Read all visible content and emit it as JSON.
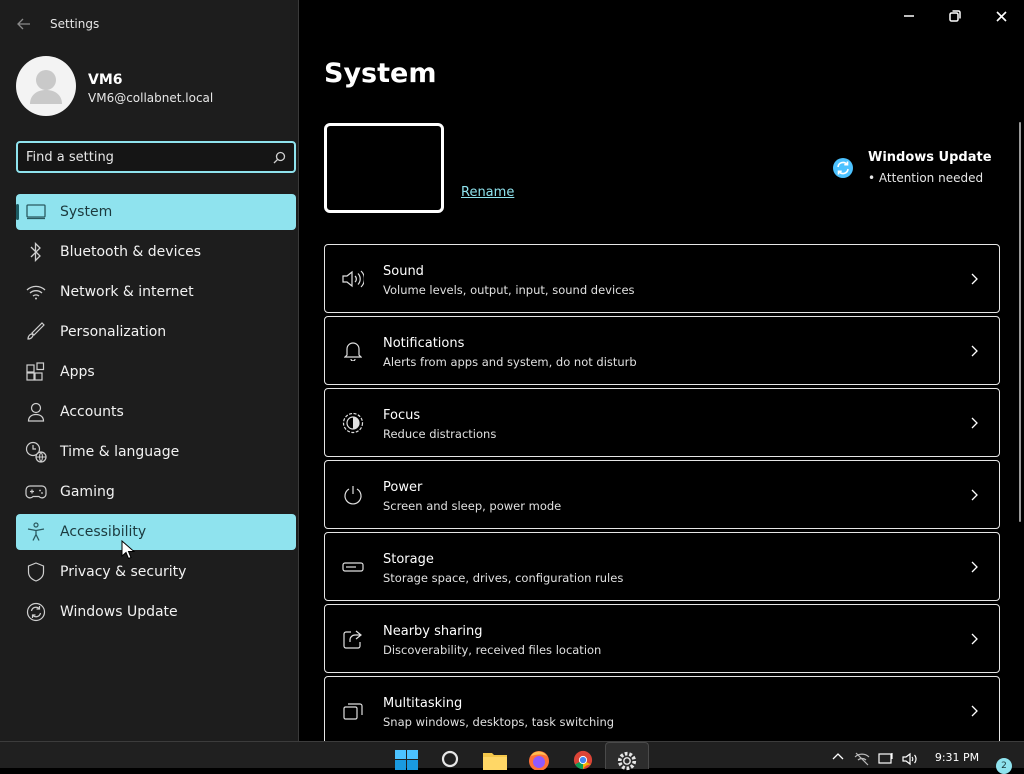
{
  "window": {
    "app_title": "Settings"
  },
  "profile": {
    "name": "VM6",
    "email": "VM6@collabnet.local"
  },
  "search": {
    "placeholder": "Find a setting",
    "value": ""
  },
  "sidebar": {
    "items": [
      {
        "label": "System",
        "icon": "monitor-icon",
        "state": "selected"
      },
      {
        "label": "Bluetooth & devices",
        "icon": "bluetooth-icon"
      },
      {
        "label": "Network & internet",
        "icon": "wifi-icon"
      },
      {
        "label": "Personalization",
        "icon": "brush-icon"
      },
      {
        "label": "Apps",
        "icon": "apps-icon"
      },
      {
        "label": "Accounts",
        "icon": "person-icon"
      },
      {
        "label": "Time & language",
        "icon": "clock-globe-icon"
      },
      {
        "label": "Gaming",
        "icon": "gamepad-icon"
      },
      {
        "label": "Accessibility",
        "icon": "accessibility-icon",
        "state": "hovered"
      },
      {
        "label": "Privacy & security",
        "icon": "shield-icon"
      },
      {
        "label": "Windows Update",
        "icon": "update-icon"
      }
    ]
  },
  "main": {
    "title": "System",
    "rename_label": "Rename",
    "windows_update": {
      "title": "Windows Update",
      "status": "Attention needed"
    },
    "cards": [
      {
        "title": "Sound",
        "desc": "Volume levels, output, input, sound devices",
        "icon": "speaker-icon"
      },
      {
        "title": "Notifications",
        "desc": "Alerts from apps and system, do not disturb",
        "icon": "bell-icon"
      },
      {
        "title": "Focus",
        "desc": "Reduce distractions",
        "icon": "focus-icon"
      },
      {
        "title": "Power",
        "desc": "Screen and sleep, power mode",
        "icon": "power-icon"
      },
      {
        "title": "Storage",
        "desc": "Storage space, drives, configuration rules",
        "icon": "storage-icon"
      },
      {
        "title": "Nearby sharing",
        "desc": "Discoverability, received files location",
        "icon": "share-icon"
      },
      {
        "title": "Multitasking",
        "desc": "Snap windows, desktops, task switching",
        "icon": "multitask-icon"
      }
    ]
  },
  "taskbar": {
    "time": "9:31 PM",
    "notification_count": "2"
  },
  "colors": {
    "accent": "#8fe3ee",
    "sidebar_bg": "#1d1d1d",
    "content_bg": "#000000",
    "taskbar_bg": "#202020"
  }
}
